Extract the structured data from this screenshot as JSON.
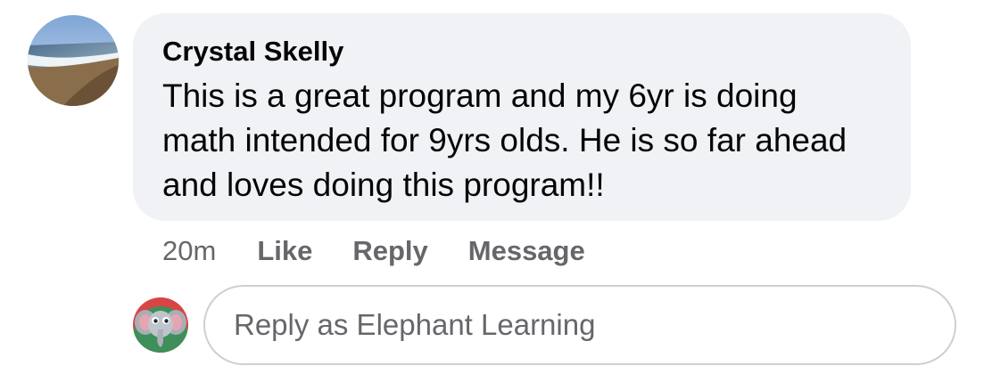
{
  "comment": {
    "author": "Crystal Skelly",
    "avatar_icon": "beach-photo-avatar",
    "text": "This is a great program and my 6yr is doing math intended for 9yrs olds. He is so far ahead and loves doing this program!!"
  },
  "actions": {
    "time": "20m",
    "like_label": "Like",
    "reply_label": "Reply",
    "message_label": "Message"
  },
  "reply": {
    "avatar_icon": "elephant-avatar",
    "placeholder": "Reply as Elephant Learning"
  },
  "colors": {
    "bubble_bg": "#f0f2f5",
    "secondary_text": "#65676b",
    "primary_text": "#050505",
    "input_border": "#ccd0d5"
  }
}
